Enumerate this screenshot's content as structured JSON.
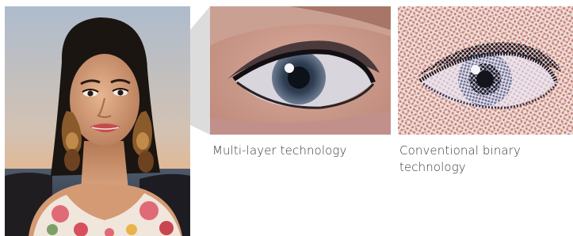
{
  "captions": {
    "multi_layer": "Multi-layer technology",
    "conventional": "Conventional binary technology"
  },
  "colors": {
    "sky_top": "#b9c4d3",
    "sky_bottom": "#e6b98a",
    "ocean": "#2f3c4c",
    "skin": "#d8a27c",
    "hair": "#1b1512",
    "lips": "#c54a4f",
    "dress_pink": "#e16a77",
    "dress_white": "#f2e8e0",
    "earring": "#8a5a2b",
    "wedge": "#dcdcdc",
    "caption_text": "#3a3a3a",
    "crop_skin": "#c99b8f",
    "binary_dot_magenta": "#c46a86",
    "binary_dot_yellow": "#d8b58a"
  },
  "images": {
    "portrait": "woman-portrait-photo",
    "multi_layer_crop": "eye-closeup-multi-layer",
    "binary_crop": "eye-closeup-halftone"
  }
}
